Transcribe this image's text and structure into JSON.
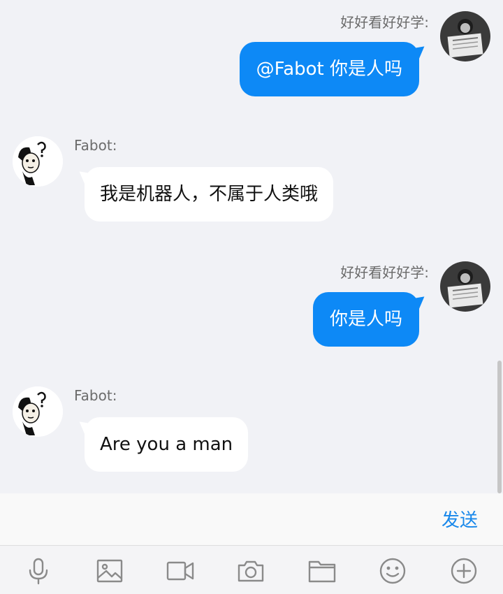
{
  "messages": [
    {
      "sender": "好好看好好学:",
      "text": "@Fabot 你是人吗",
      "direction": "out"
    },
    {
      "sender": "Fabot:",
      "text": "我是机器人，不属于人类哦",
      "direction": "in"
    },
    {
      "sender": "好好看好好学:",
      "text": "你是人吗",
      "direction": "out"
    },
    {
      "sender": "Fabot:",
      "text": "Are you a man",
      "direction": "in"
    }
  ],
  "composer": {
    "send_label": "发送"
  },
  "toolbar": {
    "icons": [
      "microphone-icon",
      "image-icon",
      "video-icon",
      "camera-icon",
      "folder-icon",
      "emoji-icon",
      "plus-circle-icon"
    ]
  },
  "colors": {
    "background": "#f1f2f6",
    "outgoing_bubble": "#0d89f6",
    "incoming_bubble": "#ffffff",
    "send_text": "#1787ea"
  }
}
